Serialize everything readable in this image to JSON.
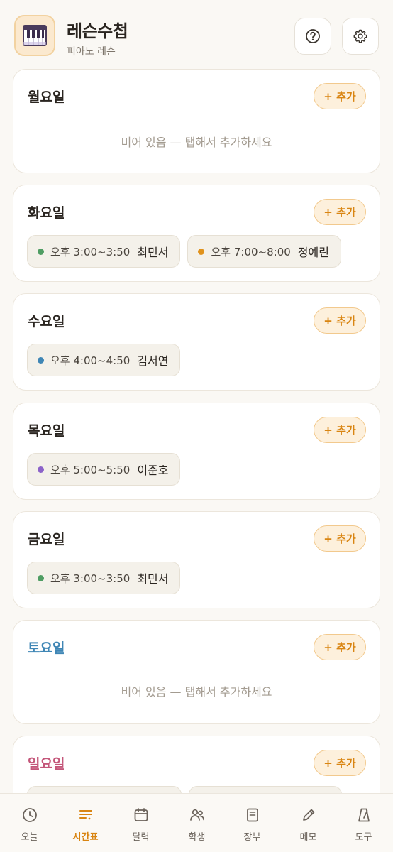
{
  "app": {
    "title": "레슨수첩",
    "subtitle": "피아노 레슨"
  },
  "icons": {
    "logo": "piano-icon",
    "help": "question-icon",
    "settings": "gear-icon"
  },
  "colors": {
    "accent": "#d98512",
    "saturday": "#3f86b5",
    "sunday": "#c4577a"
  },
  "schedule": {
    "add_label": "+ 추가",
    "empty_label": "비어 있음 — 탭해서 추가하세요",
    "days": [
      {
        "name": "월요일",
        "lessons": []
      },
      {
        "name": "화요일",
        "lessons": [
          {
            "time": "오후 3:00~3:50",
            "student": "최민서",
            "color": "#4f9d63"
          },
          {
            "time": "오후 7:00~8:00",
            "student": "정예린",
            "color": "#e0921c"
          }
        ]
      },
      {
        "name": "수요일",
        "lessons": [
          {
            "time": "오후 4:00~4:50",
            "student": "김서연",
            "color": "#3f86b5"
          }
        ]
      },
      {
        "name": "목요일",
        "lessons": [
          {
            "time": "오후 5:00~5:50",
            "student": "이준호",
            "color": "#8c63c9"
          }
        ]
      },
      {
        "name": "금요일",
        "lessons": [
          {
            "time": "오후 3:00~3:50",
            "student": "최민서",
            "color": "#4f9d63"
          }
        ]
      },
      {
        "name": "토요일",
        "lessons": []
      },
      {
        "name": "일요일",
        "lessons": []
      }
    ]
  },
  "nav": {
    "active": "시간표",
    "items": [
      {
        "label": "오늘",
        "icon": "clock-icon"
      },
      {
        "label": "시간표",
        "icon": "list-icon"
      },
      {
        "label": "달력",
        "icon": "calendar-icon"
      },
      {
        "label": "학생",
        "icon": "people-icon"
      },
      {
        "label": "장부",
        "icon": "ledger-icon"
      },
      {
        "label": "메모",
        "icon": "pencil-icon"
      },
      {
        "label": "도구",
        "icon": "metronome-icon"
      }
    ]
  }
}
